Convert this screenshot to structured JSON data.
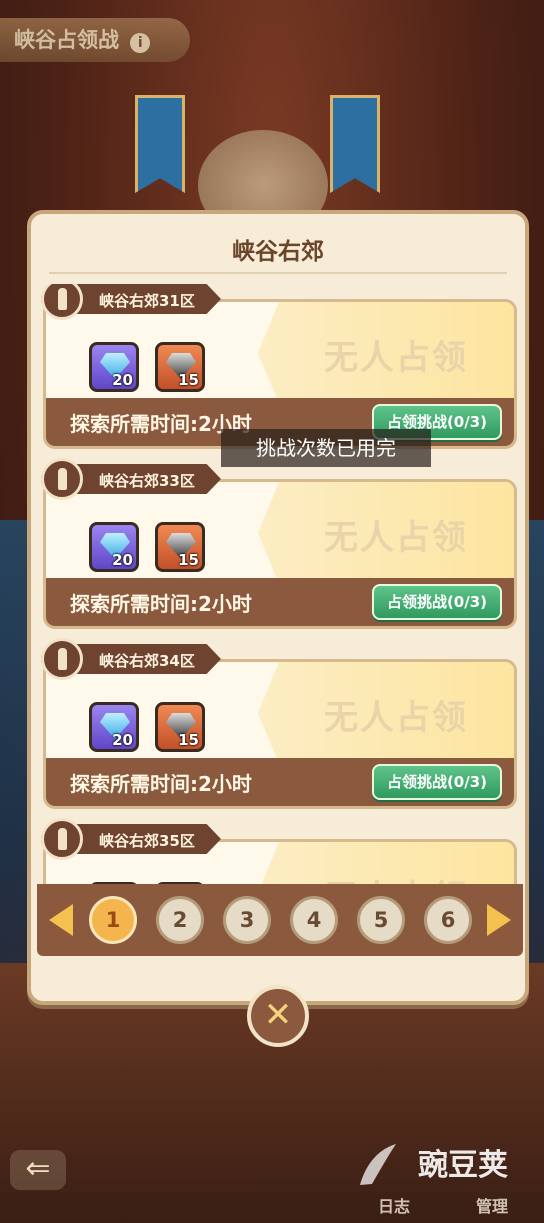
{
  "top_title": {
    "text": "峡谷占领战",
    "info": "i"
  },
  "dialog": {
    "title": "峡谷右郊",
    "toast": "挑战次数已用完",
    "cards": [
      {
        "zone": "峡谷右郊31区",
        "status": "无人占领",
        "gem_blue_count": "20",
        "gem_dark_count": "15",
        "time_label": "探索所需时间:2小时",
        "button": "占领挑战(0/3)"
      },
      {
        "zone": "峡谷右郊33区",
        "status": "无人占领",
        "gem_blue_count": "20",
        "gem_dark_count": "15",
        "time_label": "探索所需时间:2小时",
        "button": "占领挑战(0/3)"
      },
      {
        "zone": "峡谷右郊34区",
        "status": "无人占领",
        "gem_blue_count": "20",
        "gem_dark_count": "15",
        "time_label": "探索所需时间:2小时",
        "button": "占领挑战(0/3)"
      },
      {
        "zone": "峡谷右郊35区",
        "status": "无人占领"
      }
    ],
    "pages": [
      "1",
      "2",
      "3",
      "4",
      "5",
      "6"
    ],
    "active_page": "1",
    "close": "✕"
  },
  "bottom": {
    "log_label": "日志",
    "manage_label": "管理",
    "back_icon": "arrow-left-icon"
  },
  "watermark": "豌豆荚",
  "colors": {
    "accent_green": "#2f9a5f",
    "page_active": "#f5b54e",
    "panel_brown": "#8b5a3e"
  }
}
